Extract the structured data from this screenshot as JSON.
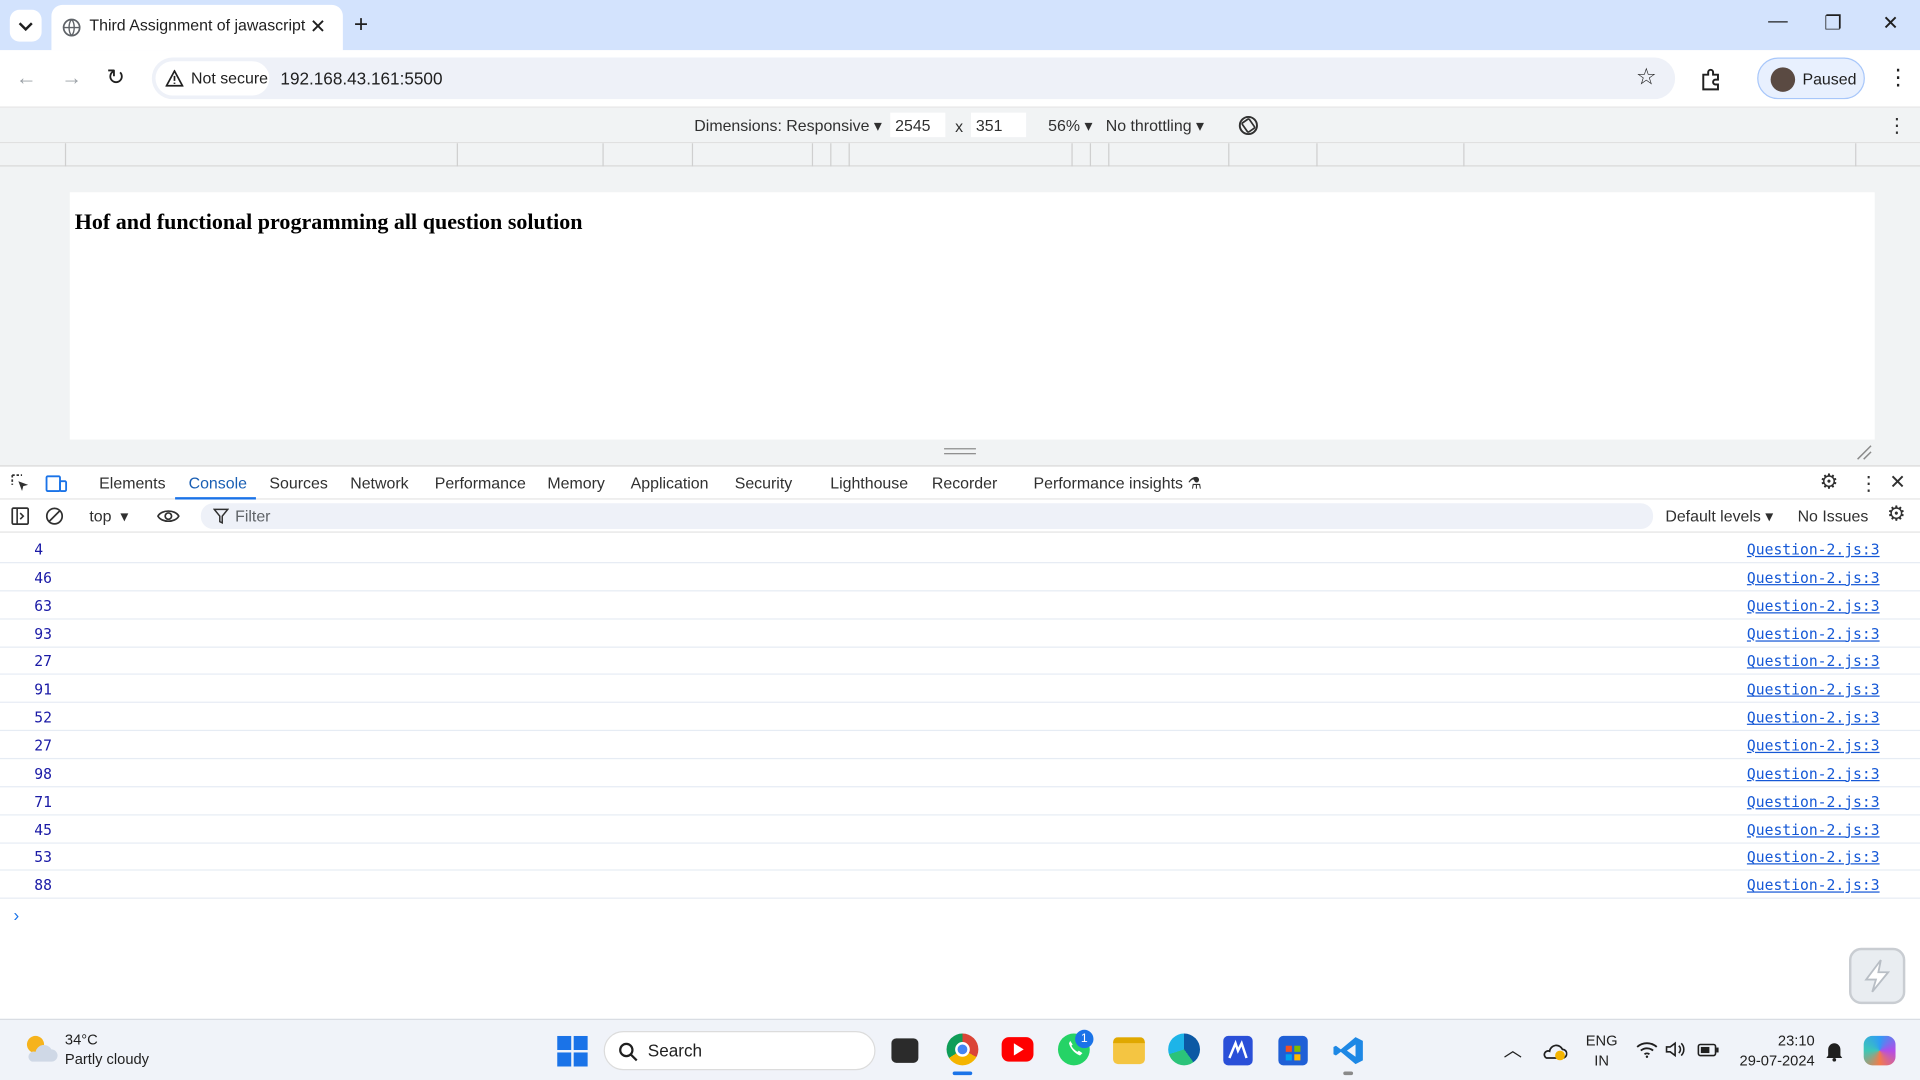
{
  "browser": {
    "tab_title": "Third Assignment of jawascript",
    "url": "192.168.43.161:5500",
    "security_label": "Not secure",
    "profile_label": "Paused"
  },
  "device_toolbar": {
    "dimensions_label": "Dimensions: Responsive",
    "width": "2545",
    "times": "x",
    "height": "351",
    "zoom": "56%",
    "throttling": "No throttling"
  },
  "page": {
    "heading": "Hof and functional programming all question solution"
  },
  "devtools": {
    "tabs": [
      "Elements",
      "Console",
      "Sources",
      "Network",
      "Performance",
      "Memory",
      "Application",
      "Security",
      "Lighthouse",
      "Recorder",
      "Performance insights"
    ],
    "active_tab": "Console",
    "context": "top",
    "filter_placeholder": "Filter",
    "levels": "Default levels",
    "issues": "No Issues"
  },
  "console": {
    "rows": [
      {
        "value": "4",
        "source": "Question-2.js:3"
      },
      {
        "value": "46",
        "source": "Question-2.js:3"
      },
      {
        "value": "63",
        "source": "Question-2.js:3"
      },
      {
        "value": "93",
        "source": "Question-2.js:3"
      },
      {
        "value": "27",
        "source": "Question-2.js:3"
      },
      {
        "value": "91",
        "source": "Question-2.js:3"
      },
      {
        "value": "52",
        "source": "Question-2.js:3"
      },
      {
        "value": "27",
        "source": "Question-2.js:3"
      },
      {
        "value": "98",
        "source": "Question-2.js:3"
      },
      {
        "value": "71",
        "source": "Question-2.js:3"
      },
      {
        "value": "45",
        "source": "Question-2.js:3"
      },
      {
        "value": "53",
        "source": "Question-2.js:3"
      },
      {
        "value": "88",
        "source": "Question-2.js:3"
      }
    ],
    "prompt": "›"
  },
  "taskbar": {
    "temperature": "34°C",
    "weather": "Partly cloudy",
    "search_label": "Search",
    "whatsapp_badge": "1",
    "lang_top": "ENG",
    "lang_bottom": "IN",
    "time": "23:10",
    "date": "29-07-2024"
  },
  "colors": {
    "tabstrip": "#d3e3fd",
    "accent": "#1a73e8",
    "console_value": "#1a1aa6",
    "console_link": "#1558d6"
  }
}
